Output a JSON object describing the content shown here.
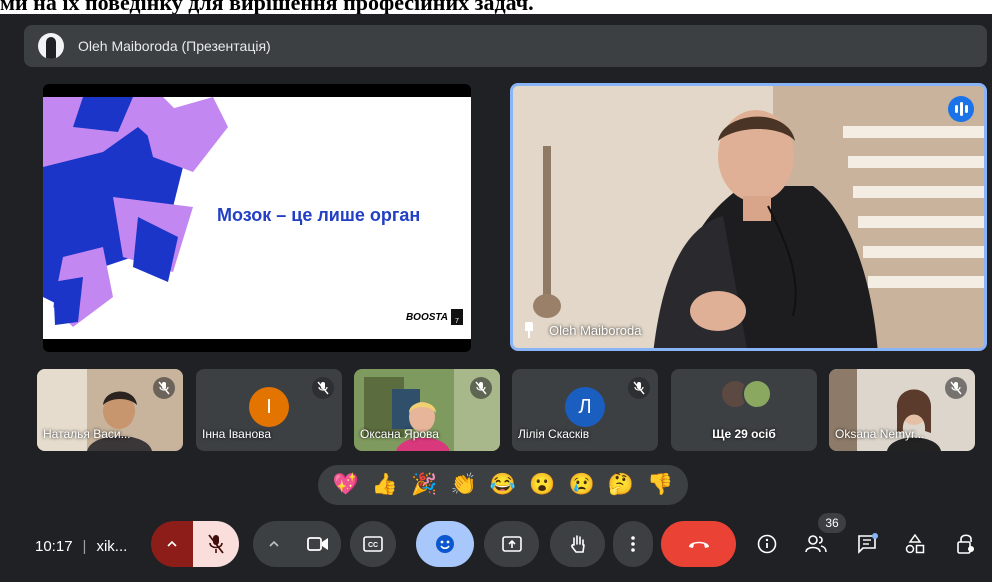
{
  "presenter_bar": {
    "title": "Oleh Maiboroda (Презентація)"
  },
  "slide": {
    "title": "Мозок – це лише орган",
    "logo_text": "BOOSTA",
    "logo_number": "7",
    "colors": {
      "violet": "#c387f2",
      "blue": "#1a35c8"
    }
  },
  "speaker": {
    "name": "Oleh Maiboroda",
    "speaking_icon": "audio-wave-icon",
    "pin_icon": "pin-icon"
  },
  "participants": [
    {
      "name": "Наталья Васи...",
      "type": "video",
      "muted": true
    },
    {
      "name": "Інна Іванова",
      "type": "initial",
      "initial": "І",
      "avatar_color": "#e37400",
      "muted": true
    },
    {
      "name": "Оксана Ярова",
      "type": "video",
      "muted": true
    },
    {
      "name": "Лілія Скасків",
      "type": "initial",
      "initial": "Л",
      "avatar_color": "#1a5ec0",
      "muted": true
    },
    {
      "name": "Ще 29 осіб",
      "type": "more"
    },
    {
      "name": "Oksana Nemyr...",
      "type": "video",
      "muted": true
    }
  ],
  "reactions": [
    "💖",
    "👍",
    "🎉",
    "👏",
    "😂",
    "😮",
    "😢",
    "🤔",
    "👎"
  ],
  "caption_strip": {
    "text": "ми на їх поведінку для вирішення професійних задач."
  },
  "bottom_bar": {
    "time": "10:17",
    "separator": "|",
    "meeting_code": "xik...",
    "people_count": "36",
    "colors": {
      "end_call": "#ea4335",
      "reaction_active": "#a8c7fa",
      "mic_off": "#f9dedc",
      "mic_arrow": "#8c1d18"
    }
  }
}
